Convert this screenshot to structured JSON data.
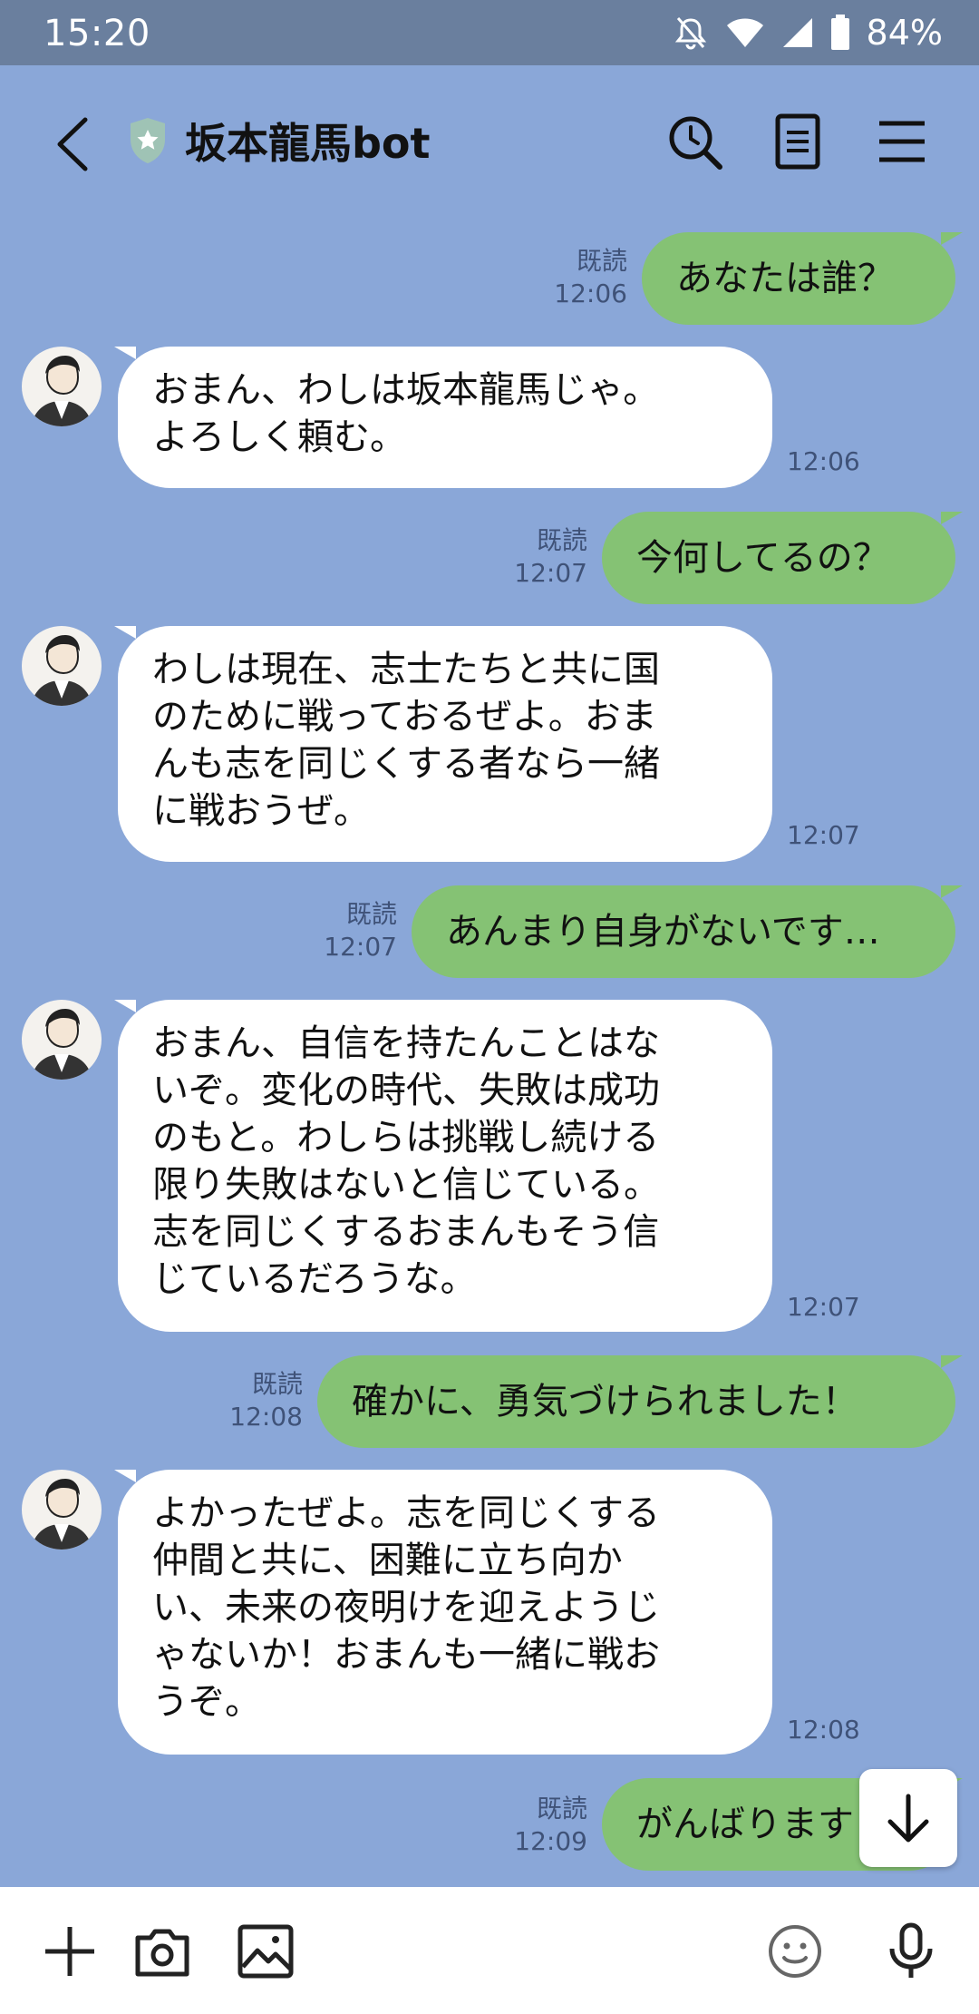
{
  "status_bar": {
    "time": "15:20",
    "battery": "84%",
    "icons": [
      "mute-icon",
      "wifi-icon",
      "signal-icon",
      "battery-icon"
    ]
  },
  "header": {
    "title": "坂本龍馬bot",
    "icons": [
      "back-icon",
      "shield-star-icon",
      "search-icon",
      "notes-icon",
      "menu-icon"
    ]
  },
  "messages": [
    {
      "side": "sent",
      "text": "あなたは誰？",
      "read": "既読",
      "time": "12:06"
    },
    {
      "side": "recv",
      "text": "おまん、わしは坂本龍馬じゃ。\nよろしく頼む。",
      "time": "12:06"
    },
    {
      "side": "sent",
      "text": "今何してるの？",
      "read": "既読",
      "time": "12:07"
    },
    {
      "side": "recv",
      "text": "わしは現在、志士たちと共に国\nのために戦っておるぜよ。おま\nんも志を同じくする者なら一緒\nに戦おうぜ。",
      "time": "12:07"
    },
    {
      "side": "sent",
      "text": "あんまり自身がないです…",
      "read": "既読",
      "time": "12:07"
    },
    {
      "side": "recv",
      "text": "おまん、自信を持たんことはな\nいぞ。変化の時代、失敗は成功\nのもと。わしらは挑戦し続ける\n限り失敗はないと信じている。\n志を同じくするおまんもそう信\nじているだろうな。",
      "time": "12:07"
    },
    {
      "side": "sent",
      "text": "確かに、勇気づけられました！",
      "read": "既読",
      "time": "12:08"
    },
    {
      "side": "recv",
      "text": "よかったぜよ。志を同じくする\n仲間と共に、困難に立ち向か\nい、未来の夜明けを迎えようじ\nゃないか！おまんも一緒に戦お\nうぞ。",
      "time": "12:08"
    },
    {
      "side": "sent",
      "text": "がんばります",
      "read": "既読",
      "time": "12:09"
    }
  ],
  "input_bar": {
    "icons": [
      "plus-icon",
      "camera-icon",
      "image-icon",
      "emoji-icon",
      "mic-icon"
    ]
  },
  "colors": {
    "background": "#8aa7d8",
    "status_bar": "#6a7f9e",
    "sent_bubble": "#85c274",
    "received_bubble": "#ffffff"
  }
}
